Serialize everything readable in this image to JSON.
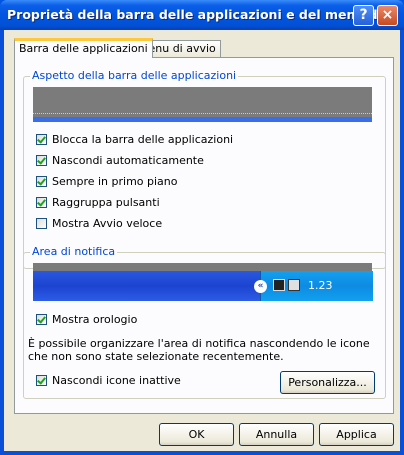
{
  "window": {
    "title": "Proprietà della barra delle applicazioni e del menu d...",
    "help_button": "?",
    "close_button": "×"
  },
  "tabs": [
    {
      "label": "Barra delle applicazioni",
      "active": true
    },
    {
      "label": "Menu di avvio",
      "active": false
    }
  ],
  "appearance": {
    "title": "Aspetto della barra delle applicazioni",
    "options": [
      {
        "label": "Blocca la barra delle applicazioni",
        "checked": true
      },
      {
        "label": "Nascondi automaticamente",
        "checked": true
      },
      {
        "label": "Sempre in primo piano",
        "checked": true
      },
      {
        "label": "Raggruppa pulsanti",
        "checked": true
      },
      {
        "label": "Mostra Avvio veloce",
        "checked": false
      }
    ]
  },
  "notification": {
    "title": "Area di notifica",
    "clock_preview": "1.23",
    "show_clock": {
      "label": "Mostra orologio",
      "checked": true
    },
    "description": "È possibile organizzare l'area di notifica nascondendo le icone che non sono state selezionate recentemente.",
    "hide_inactive": {
      "label": "Nascondi icone inattive",
      "checked": true
    },
    "customize_button": "Personalizza..."
  },
  "footer": {
    "ok": "OK",
    "cancel": "Annulla",
    "apply": "Applica"
  },
  "colors": {
    "titlebar": "#0054e3",
    "dialog_bg": "#ece9d8",
    "group_title": "#0046d5"
  }
}
